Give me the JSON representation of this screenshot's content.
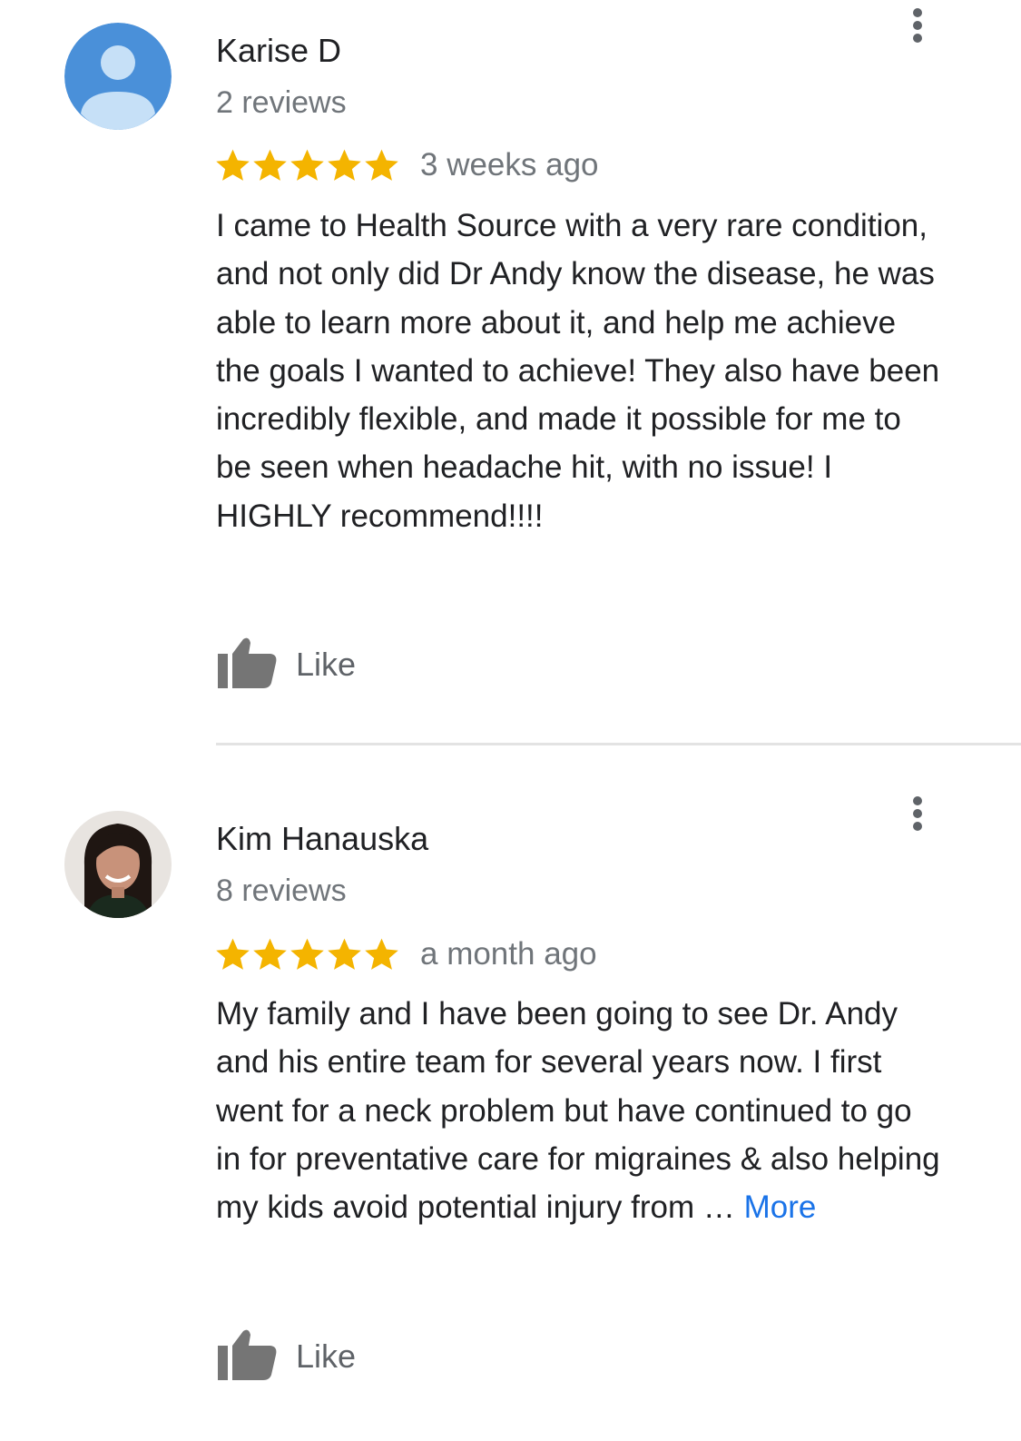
{
  "reviews": [
    {
      "author": "Karise D",
      "review_count": "2 reviews",
      "rating": 5,
      "date": "3 weeks ago",
      "text": "I came to Health Source with a very rare condition, and not only did Dr Andy know the disease, he was able to learn more about it, and help me achieve the goals I wanted to achieve! They also have been incredibly flexible, and made it possible for me to be seen when headache hit, with no issue! I HIGHLY recommend!!!!",
      "more_label": "",
      "like_label": "Like",
      "avatar": "default-person-icon"
    },
    {
      "author": "Kim Hanauska",
      "review_count": "8 reviews",
      "rating": 5,
      "date": "a month ago",
      "text": "My family and I have been going to see Dr. Andy and his entire team for several years now. I first went for a neck problem but have continued to go in for preventative care for migraines & also helping my kids avoid potential injury from … ",
      "more_label": "More",
      "like_label": "Like",
      "avatar": "profile-photo"
    }
  ],
  "colors": {
    "star": "#F4B400",
    "link": "#1a73e8",
    "secondary_text": "#70757a",
    "default_avatar": "#4A90D9"
  }
}
